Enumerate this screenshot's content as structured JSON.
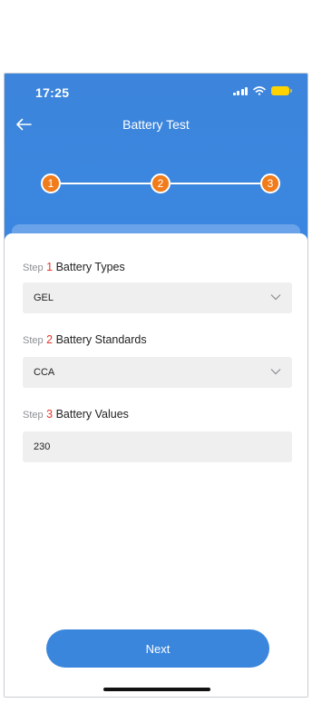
{
  "status_bar": {
    "time": "17:25",
    "battery_color": "#ffd300"
  },
  "header": {
    "title": "Battery Test",
    "back_icon": "arrow-left-icon",
    "bg_color": "#3a86e0"
  },
  "stepper": {
    "steps": [
      "1",
      "2",
      "3"
    ],
    "active_color": "#f07c1b"
  },
  "form": {
    "step_word": "Step",
    "sections": [
      {
        "number": "1",
        "label": "Battery Types",
        "value": "GEL",
        "has_dropdown": true
      },
      {
        "number": "2",
        "label": "Battery Standards",
        "value": "CCA",
        "has_dropdown": true
      },
      {
        "number": "3",
        "label": "Battery Values",
        "value": "230",
        "has_dropdown": false
      }
    ]
  },
  "actions": {
    "next_label": "Next",
    "button_color": "#3b86dd"
  }
}
